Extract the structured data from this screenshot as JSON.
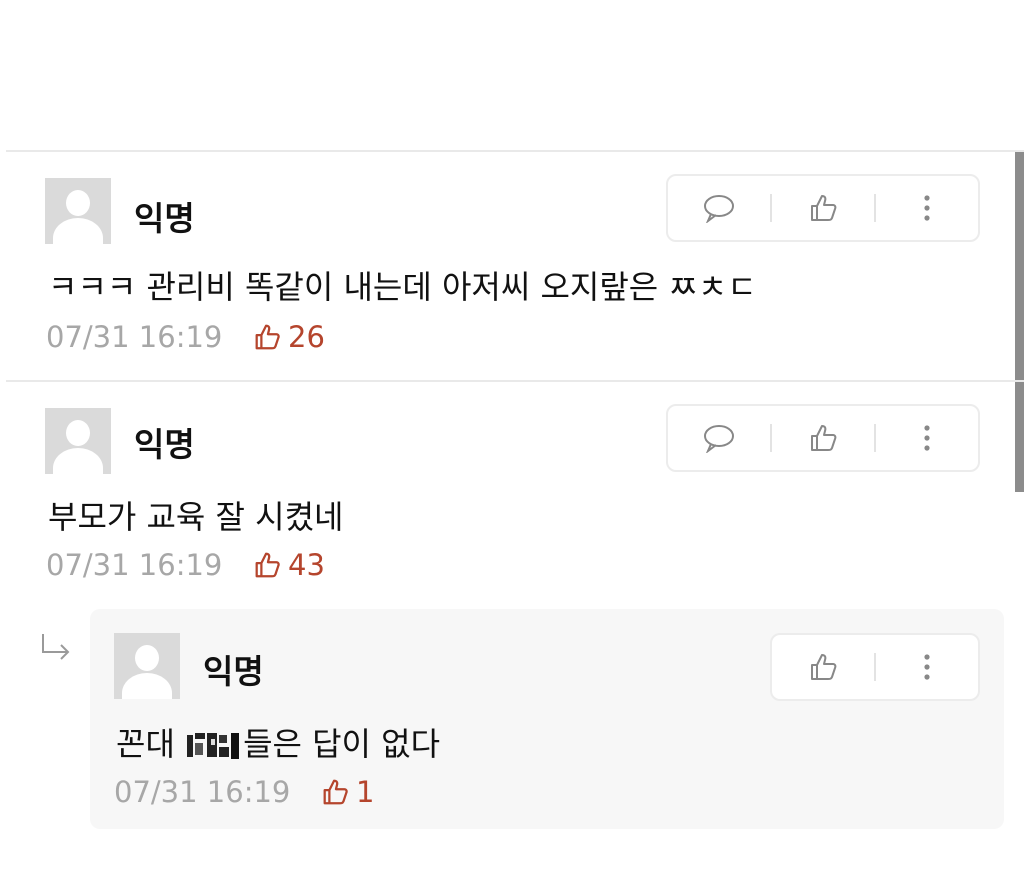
{
  "comments": [
    {
      "author": "익명",
      "text": "ㅋㅋㅋ 관리비 똑같이 내는데 아저씨 오지랖은 ㅉㅊㄷ",
      "time": "07/31 16:19",
      "likes": "26",
      "actions": [
        "comment-icon",
        "thumbs-up-icon",
        "more-vertical-icon"
      ]
    },
    {
      "author": "익명",
      "text": "부모가 교육 잘 시켰네",
      "time": "07/31 16:19",
      "likes": "43",
      "actions": [
        "comment-icon",
        "thumbs-up-icon",
        "more-vertical-icon"
      ]
    }
  ],
  "reply": {
    "author": "익명",
    "text_before": "꼰대 ",
    "text_after": "들은 답이 없다",
    "time": "07/31 16:19",
    "likes": "1",
    "actions": [
      "thumbs-up-icon",
      "more-vertical-icon"
    ]
  },
  "colors": {
    "like_accent": "#b5452d",
    "meta_gray": "#a7a7a7",
    "avatar_gray": "#dadada",
    "reply_bg": "#f7f7f7"
  }
}
